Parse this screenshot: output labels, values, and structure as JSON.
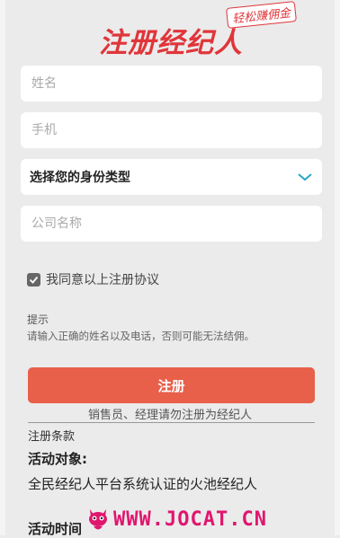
{
  "brand": {
    "title": "注册经纪人",
    "tag": "轻松赚佣金"
  },
  "form": {
    "name_placeholder": "姓名",
    "phone_placeholder": "手机",
    "identity_label": "选择您的身份类型",
    "company_placeholder": "公司名称",
    "agree_label": "我同意以上注册协议",
    "agree_checked": true
  },
  "tip": {
    "title": "提示",
    "text": "请输入正确的姓名以及电话，否则可能无法结佣。"
  },
  "register_button": "注册",
  "note": "销售员、经理请勿注册为经纪人",
  "terms": {
    "title": "注册条款",
    "heading": "活动对象:",
    "body": "全民经纪人平台系统认证的火池经纪人",
    "next_heading": "活动时间"
  },
  "watermark": "WWW.JOCAT.CN",
  "colors": {
    "accent": "#e0353a",
    "button": "#e8604a",
    "chevron": "#2aa6c8",
    "watermark": "#e0166e"
  }
}
